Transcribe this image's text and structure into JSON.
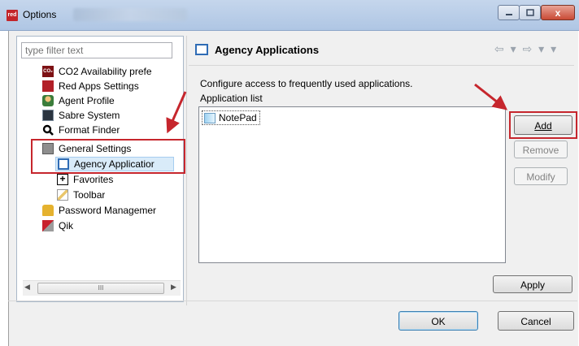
{
  "window": {
    "title": "Options",
    "logo_text": "red",
    "close_glyph": "x"
  },
  "filter": {
    "placeholder": "type filter text"
  },
  "tree": {
    "items": [
      {
        "label": "CO2 Availability prefe",
        "icon": "co2-icon",
        "badge": "CO₂"
      },
      {
        "label": "Red Apps Settings",
        "icon": "red-apps-icon"
      },
      {
        "label": "Agent Profile",
        "icon": "agent-profile-icon"
      },
      {
        "label": "Sabre System",
        "icon": "sabre-system-icon"
      },
      {
        "label": "Format Finder",
        "icon": "magnifier-icon"
      },
      {
        "label": "General Settings",
        "icon": "general-settings-icon"
      },
      {
        "label": "Agency Applicatior",
        "icon": "window-icon"
      },
      {
        "label": "Favorites",
        "icon": "plus-box-icon"
      },
      {
        "label": "Toolbar",
        "icon": "toolbar-icon"
      },
      {
        "label": "Password Managemer",
        "icon": "lock-icon"
      },
      {
        "label": "Qik",
        "icon": "qik-icon"
      }
    ],
    "scroll_thumb": "III"
  },
  "page": {
    "title": "Agency Applications",
    "nav": "⇦ ▾ ⇨ ▾ ▾",
    "description": "Configure access to frequently used applications.",
    "list_label": "Application list",
    "applications": [
      "NotePad"
    ]
  },
  "buttons": {
    "add": "Add",
    "remove": "Remove",
    "modify": "Modify",
    "apply": "Apply",
    "ok": "OK",
    "cancel": "Cancel"
  },
  "colors": {
    "highlight_red": "#c6262d",
    "title_bar": "#c5d6ec",
    "selected_item_bg": "#d9ebf9"
  }
}
